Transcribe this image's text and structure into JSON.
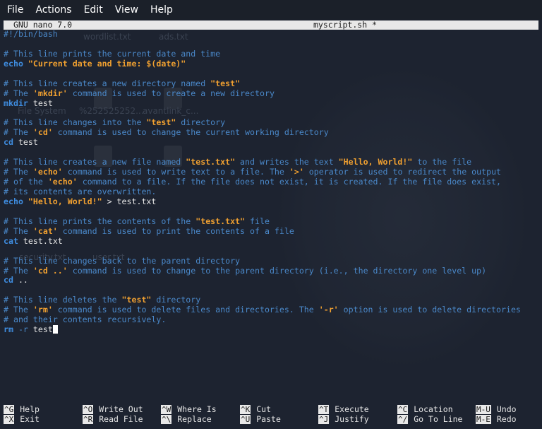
{
  "menu": [
    "File",
    "Actions",
    "Edit",
    "View",
    "Help"
  ],
  "titlebar": {
    "version": "GNU nano 7.0",
    "filename": "myscript.sh *"
  },
  "desktop_ghosts": [
    "wordlist.txt",
    "ads.txt",
    "File System",
    "%252525252...",
    "avantlink_c...",
    "security.txt",
    "user.txt"
  ],
  "code_lines": [
    [
      {
        "t": "#!/bin/bash",
        "c": "comment"
      }
    ],
    [],
    [
      {
        "t": "# This line prints the current date and time",
        "c": "comment"
      }
    ],
    [
      {
        "t": "echo",
        "c": "kw"
      },
      {
        "t": " ",
        "c": "plain"
      },
      {
        "t": "\"Current date and time: $(date)\"",
        "c": "str"
      }
    ],
    [],
    [
      {
        "t": "# This line creates a new directory named ",
        "c": "comment"
      },
      {
        "t": "\"test\"",
        "c": "str"
      }
    ],
    [
      {
        "t": "# The ",
        "c": "comment"
      },
      {
        "t": "'mkdir'",
        "c": "str"
      },
      {
        "t": " command is used to create a new directory",
        "c": "comment"
      }
    ],
    [
      {
        "t": "mkdir",
        "c": "kw"
      },
      {
        "t": " test",
        "c": "plain"
      }
    ],
    [],
    [
      {
        "t": "# This line changes into the ",
        "c": "comment"
      },
      {
        "t": "\"test\"",
        "c": "str"
      },
      {
        "t": " directory",
        "c": "comment"
      }
    ],
    [
      {
        "t": "# The ",
        "c": "comment"
      },
      {
        "t": "'cd'",
        "c": "str"
      },
      {
        "t": " command is used to change the current working directory",
        "c": "comment"
      }
    ],
    [
      {
        "t": "cd",
        "c": "kw"
      },
      {
        "t": " test",
        "c": "plain"
      }
    ],
    [],
    [
      {
        "t": "# This line creates a new file named ",
        "c": "comment"
      },
      {
        "t": "\"test.txt\"",
        "c": "str"
      },
      {
        "t": " and writes the text ",
        "c": "comment"
      },
      {
        "t": "\"Hello, World!\"",
        "c": "str"
      },
      {
        "t": " to the file",
        "c": "comment"
      }
    ],
    [
      {
        "t": "# The ",
        "c": "comment"
      },
      {
        "t": "'echo'",
        "c": "str"
      },
      {
        "t": " command is used to write text to a file. The ",
        "c": "comment"
      },
      {
        "t": "'>'",
        "c": "str"
      },
      {
        "t": " operator is used to redirect the output",
        "c": "comment"
      }
    ],
    [
      {
        "t": "# of the ",
        "c": "comment"
      },
      {
        "t": "'echo'",
        "c": "str"
      },
      {
        "t": " command to a file. If the file does not exist, it is created. If the file does exist,",
        "c": "comment"
      }
    ],
    [
      {
        "t": "# its contents are overwritten.",
        "c": "comment"
      }
    ],
    [
      {
        "t": "echo",
        "c": "kw"
      },
      {
        "t": " ",
        "c": "plain"
      },
      {
        "t": "\"Hello, World!\"",
        "c": "str"
      },
      {
        "t": " > test.txt",
        "c": "plain"
      }
    ],
    [],
    [
      {
        "t": "# This line prints the contents of the ",
        "c": "comment"
      },
      {
        "t": "\"test.txt\"",
        "c": "str"
      },
      {
        "t": " file",
        "c": "comment"
      }
    ],
    [
      {
        "t": "# The ",
        "c": "comment"
      },
      {
        "t": "'cat'",
        "c": "str"
      },
      {
        "t": " command is used to print the contents of a file",
        "c": "comment"
      }
    ],
    [
      {
        "t": "cat",
        "c": "kw"
      },
      {
        "t": " test.txt",
        "c": "plain"
      }
    ],
    [],
    [
      {
        "t": "# This line changes back to the parent directory",
        "c": "comment"
      }
    ],
    [
      {
        "t": "# The ",
        "c": "comment"
      },
      {
        "t": "'cd ..'",
        "c": "str"
      },
      {
        "t": " command is used to change to the parent directory (i.e., the directory one level up)",
        "c": "comment"
      }
    ],
    [
      {
        "t": "cd",
        "c": "kw"
      },
      {
        "t": " ..",
        "c": "plain"
      }
    ],
    [],
    [
      {
        "t": "# This line deletes the ",
        "c": "comment"
      },
      {
        "t": "\"test\"",
        "c": "str"
      },
      {
        "t": " directory",
        "c": "comment"
      }
    ],
    [
      {
        "t": "# The ",
        "c": "comment"
      },
      {
        "t": "'rm'",
        "c": "str"
      },
      {
        "t": " command is used to delete files and directories. The ",
        "c": "comment"
      },
      {
        "t": "'-r'",
        "c": "str"
      },
      {
        "t": " option is used to delete directories",
        "c": "comment"
      }
    ],
    [
      {
        "t": "# and their contents recursively.",
        "c": "comment"
      }
    ],
    [
      {
        "t": "rm",
        "c": "kw"
      },
      {
        "t": " -r",
        "c": "flag"
      },
      {
        "t": " test",
        "c": "plain"
      }
    ]
  ],
  "cursor_line": 30,
  "shortcuts": [
    [
      {
        "key": "^G",
        "label": "Help"
      },
      {
        "key": "^X",
        "label": "Exit"
      }
    ],
    [
      {
        "key": "^O",
        "label": "Write Out"
      },
      {
        "key": "^R",
        "label": "Read File"
      }
    ],
    [
      {
        "key": "^W",
        "label": "Where Is"
      },
      {
        "key": "^\\",
        "label": "Replace"
      }
    ],
    [
      {
        "key": "^K",
        "label": "Cut"
      },
      {
        "key": "^U",
        "label": "Paste"
      }
    ],
    [
      {
        "key": "^T",
        "label": "Execute"
      },
      {
        "key": "^J",
        "label": "Justify"
      }
    ],
    [
      {
        "key": "^C",
        "label": "Location"
      },
      {
        "key": "^/",
        "label": "Go To Line"
      }
    ],
    [
      {
        "key": "M-U",
        "label": "Undo"
      },
      {
        "key": "M-E",
        "label": "Redo"
      }
    ]
  ],
  "colors": {
    "background": "#1d2330",
    "comment": "#4a88c9",
    "keyword": "#3f8de0",
    "string": "#f0a030",
    "text": "#e6e6e6",
    "titlebar_bg": "#e8e8e8"
  }
}
